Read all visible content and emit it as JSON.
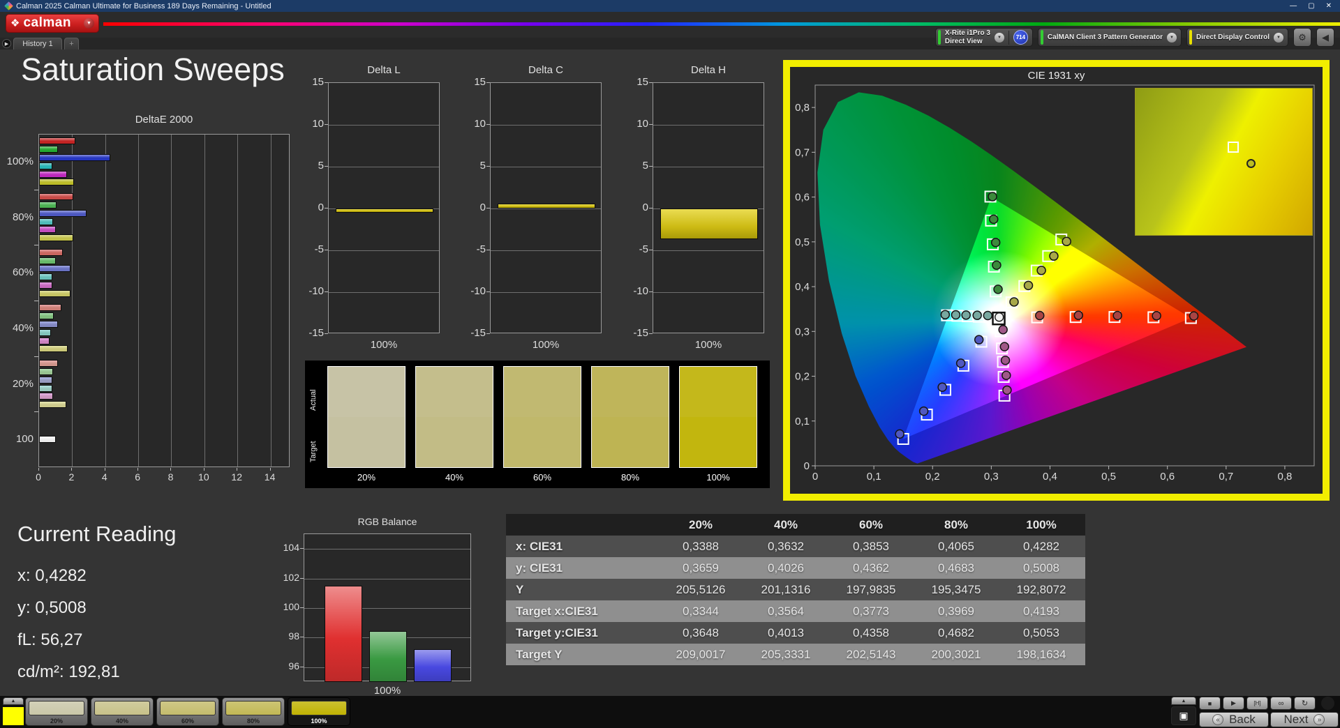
{
  "window": {
    "title": "Calman 2025 Calman Ultimate for Business 189 Days Remaining  - Untitled",
    "minimize": "—",
    "maximize": "▢",
    "close": "✕"
  },
  "header": {
    "brand": "calman",
    "brand_dropdown": "▼"
  },
  "tab_bar": {
    "nav_arrow": "▶",
    "history_tab": "History 1",
    "add_tab": "+"
  },
  "meter_bar": {
    "meter": {
      "line1": "X-Rite i1Pro 3",
      "line2": "Direct View",
      "badge": "714",
      "status_color": "#33cc33"
    },
    "source": {
      "label": "CalMAN Client 3 Pattern Generator",
      "status_color": "#33cc33"
    },
    "display": {
      "label": "Direct Display Control",
      "status_color": "#e8e000"
    },
    "settings_icon": "⚙",
    "collapse_icon": "◀",
    "dropdown_icon": "▼"
  },
  "page_title": "Saturation Sweeps",
  "current_reading": {
    "title": "Current Reading",
    "lines": [
      "x: 0,4282",
      "y: 0,5008",
      "fL: 56,27",
      "cd/m²: 192,81"
    ]
  },
  "results_table": {
    "columns": [
      "20%",
      "40%",
      "60%",
      "80%",
      "100%"
    ],
    "rows": [
      {
        "label": "x: CIE31",
        "values": [
          "0,3388",
          "0,3632",
          "0,3853",
          "0,4065",
          "0,4282"
        ]
      },
      {
        "label": "y: CIE31",
        "values": [
          "0,3659",
          "0,4026",
          "0,4362",
          "0,4683",
          "0,5008"
        ]
      },
      {
        "label": "Y",
        "values": [
          "205,5126",
          "201,1316",
          "197,9835",
          "195,3475",
          "192,8072"
        ]
      },
      {
        "label": "Target x:CIE31",
        "values": [
          "0,3344",
          "0,3564",
          "0,3773",
          "0,3969",
          "0,4193"
        ]
      },
      {
        "label": "Target y:CIE31",
        "values": [
          "0,3648",
          "0,4013",
          "0,4358",
          "0,4682",
          "0,5053"
        ]
      },
      {
        "label": "Target Y",
        "values": [
          "209,0017",
          "205,3331",
          "202,5143",
          "200,3021",
          "198,1634"
        ]
      }
    ]
  },
  "swatch_panel": {
    "row_labels": [
      "Actual",
      "Target"
    ],
    "levels": [
      "20%",
      "40%",
      "60%",
      "80%",
      "100%"
    ],
    "actual_colors": [
      "#c7c3a6",
      "#c4be8c",
      "#c1b971",
      "#bfb55a",
      "#c4b81b"
    ],
    "target_colors": [
      "#c5c1a1",
      "#c2bc86",
      "#c0b86b",
      "#beb453",
      "#c2b60e"
    ]
  },
  "pattern_bar": {
    "expand_icon": "▲",
    "preview_color": "#ffff00",
    "buttons": [
      {
        "label": "20%",
        "color": "#c9c7a8",
        "selected": false
      },
      {
        "label": "40%",
        "color": "#c7c189",
        "selected": false
      },
      {
        "label": "60%",
        "color": "#c4bc6d",
        "selected": false
      },
      {
        "label": "80%",
        "color": "#c2b855",
        "selected": false
      },
      {
        "label": "100%",
        "color": "#c0b203",
        "selected": true
      }
    ]
  },
  "transport": {
    "expand_icon": "▲",
    "pattern_toggle_icon": "▣",
    "stop_icon": "■",
    "play_icon": "▶",
    "single_icon": "[H]",
    "loop_icon": "∞",
    "refresh_icon": "↻",
    "back_arrow": "«",
    "back_label": "Back",
    "next_label": "Next",
    "next_arrow": "»"
  },
  "chart_data": [
    {
      "id": "deltae2000",
      "type": "bar",
      "orientation": "horizontal",
      "title": "DeltaE 2000",
      "xlim": [
        0,
        15.2
      ],
      "xticks": [
        0,
        2,
        4,
        6,
        8,
        10,
        12,
        14
      ],
      "grid": true,
      "series_names": [
        "red",
        "green",
        "blue",
        "cyan",
        "magenta",
        "yellow"
      ],
      "series_colors": [
        "#c32424",
        "#24a832",
        "#2636c0",
        "#28b4b4",
        "#bc28bc",
        "#bcbc28"
      ],
      "white_color": "#ececec",
      "groups": [
        {
          "label": "100%",
          "tint": 0,
          "values": [
            2.2,
            1.15,
            4.3,
            0.8,
            1.7,
            2.1
          ]
        },
        {
          "label": "80%",
          "tint": 0.22,
          "values": [
            2.05,
            1.05,
            2.85,
            0.85,
            1.0,
            2.05
          ]
        },
        {
          "label": "60%",
          "tint": 0.38,
          "values": [
            1.45,
            1.0,
            1.9,
            0.8,
            0.8,
            1.9
          ]
        },
        {
          "label": "40%",
          "tint": 0.52,
          "values": [
            1.35,
            0.9,
            1.15,
            0.7,
            0.65,
            1.75
          ]
        },
        {
          "label": "20%",
          "tint": 0.65,
          "values": [
            1.15,
            0.85,
            0.8,
            0.8,
            0.85,
            1.65
          ]
        },
        {
          "label": "100",
          "tint": 0,
          "values": [
            1.0
          ],
          "white": true
        }
      ]
    },
    {
      "id": "deltaL",
      "type": "bar",
      "title": "Delta L",
      "categories": [
        "100%"
      ],
      "values": [
        -0.5
      ],
      "ylim": [
        -15,
        15
      ],
      "yticks": [
        15,
        10,
        5,
        0,
        -5,
        -10,
        -15
      ],
      "bar_color": "#cdbb14"
    },
    {
      "id": "deltaC",
      "type": "bar",
      "title": "Delta C",
      "categories": [
        "100%"
      ],
      "values": [
        0.6
      ],
      "ylim": [
        -15,
        15
      ],
      "yticks": [
        15,
        10,
        5,
        0,
        -5,
        -10,
        -15
      ],
      "bar_color": "#cdbb14"
    },
    {
      "id": "deltaH",
      "type": "bar",
      "title": "Delta H",
      "categories": [
        "100%"
      ],
      "values": [
        -3.7
      ],
      "ylim": [
        -15,
        15
      ],
      "yticks": [
        15,
        10,
        5,
        0,
        -5,
        -10,
        -15
      ],
      "bar_color": "#cdbb14"
    },
    {
      "id": "rgbbalance",
      "type": "bar",
      "title": "RGB Balance",
      "categories": [
        "100%"
      ],
      "xlabel": "100%",
      "ylim": [
        95,
        105
      ],
      "yticks": [
        96,
        98,
        100,
        102,
        104
      ],
      "series": [
        {
          "name": "Red",
          "value": 101.5,
          "color": "#e03030"
        },
        {
          "name": "Green",
          "value": 98.45,
          "color": "#3a9a42"
        },
        {
          "name": "Blue",
          "value": 97.2,
          "color": "#4848e0"
        }
      ]
    },
    {
      "id": "cie",
      "type": "scatter",
      "title": "CIE 1931 xy",
      "xlim": [
        0,
        0.85
      ],
      "ylim": [
        0,
        0.85
      ],
      "xticks": [
        "0",
        "0,1",
        "0,2",
        "0,3",
        "0,4",
        "0,5",
        "0,6",
        "0,7",
        "0,8"
      ],
      "yticks": [
        "0",
        "0,1",
        "0,2",
        "0,3",
        "0,4",
        "0,5",
        "0,6",
        "0,7",
        "0,8"
      ],
      "gamut_triangle": {
        "red": [
          0.64,
          0.33
        ],
        "green": [
          0.3,
          0.6
        ],
        "blue": [
          0.15,
          0.06
        ]
      },
      "white_point": {
        "target": [
          0.3127,
          0.329
        ],
        "measured": [
          0.3135,
          0.332
        ]
      },
      "sweeps": [
        {
          "name": "red",
          "color": "#a84444",
          "targets": [
            [
              0.3781,
              0.3314
            ],
            [
              0.4437,
              0.3321
            ],
            [
              0.5099,
              0.3322
            ],
            [
              0.5763,
              0.3317
            ],
            [
              0.64,
              0.33
            ]
          ],
          "measured": [
            [
              0.3825,
              0.3355
            ],
            [
              0.4485,
              0.336
            ],
            [
              0.515,
              0.3355
            ],
            [
              0.5815,
              0.335
            ],
            [
              0.645,
              0.3345
            ]
          ]
        },
        {
          "name": "green",
          "color": "#3c8a3c",
          "targets": [
            [
              0.3075,
              0.3895
            ],
            [
              0.3045,
              0.4446
            ],
            [
              0.3025,
              0.4945
            ],
            [
              0.2995,
              0.5474
            ],
            [
              0.2985,
              0.601
            ]
          ],
          "measured": [
            [
              0.3115,
              0.394
            ],
            [
              0.309,
              0.448
            ],
            [
              0.3075,
              0.4985
            ],
            [
              0.304,
              0.5505
            ],
            [
              0.302,
              0.601
            ]
          ]
        },
        {
          "name": "blue",
          "color": "#5058c0",
          "targets": [
            [
              0.2831,
              0.2771
            ],
            [
              0.2525,
              0.2235
            ],
            [
              0.2217,
              0.1696
            ],
            [
              0.1903,
              0.1143
            ],
            [
              0.15,
              0.06
            ]
          ],
          "measured": [
            [
              0.279,
              0.2815
            ],
            [
              0.248,
              0.229
            ],
            [
              0.2165,
              0.1755
            ],
            [
              0.185,
              0.122
            ],
            [
              0.144,
              0.071
            ]
          ]
        },
        {
          "name": "cyan",
          "color": "#78a8a0",
          "targets": [
            [
              0.297,
              0.3322
            ],
            [
              0.2788,
              0.333
            ],
            [
              0.2598,
              0.334
            ],
            [
              0.2423,
              0.335
            ],
            [
              0.2246,
              0.336
            ]
          ],
          "measured": [
            [
              0.294,
              0.3355
            ],
            [
              0.276,
              0.336
            ],
            [
              0.257,
              0.3365
            ],
            [
              0.2395,
              0.337
            ],
            [
              0.2215,
              0.3375
            ]
          ]
        },
        {
          "name": "magenta",
          "color": "#a05888",
          "targets": [
            [
              0.316,
              0.3005
            ],
            [
              0.3182,
              0.262
            ],
            [
              0.3199,
              0.232
            ],
            [
              0.3211,
              0.1985
            ],
            [
              0.3224,
              0.1566
            ]
          ],
          "measured": [
            [
              0.32,
              0.304
            ],
            [
              0.3225,
              0.266
            ],
            [
              0.324,
              0.2355
            ],
            [
              0.3255,
              0.202
            ],
            [
              0.3268,
              0.169
            ]
          ]
        },
        {
          "name": "yellow",
          "color": "#a8a848",
          "targets": [
            [
              0.3344,
              0.3648
            ],
            [
              0.3564,
              0.4013
            ],
            [
              0.3773,
              0.4358
            ],
            [
              0.3969,
              0.4682
            ],
            [
              0.4193,
              0.5053
            ]
          ],
          "measured": [
            [
              0.3388,
              0.3659
            ],
            [
              0.3632,
              0.4026
            ],
            [
              0.3853,
              0.4362
            ],
            [
              0.4065,
              0.4683
            ],
            [
              0.4282,
              0.5008
            ]
          ]
        }
      ],
      "inset": {
        "target": [
          0.4193,
          0.5053
        ],
        "measured": [
          0.4282,
          0.5008
        ]
      }
    }
  ]
}
